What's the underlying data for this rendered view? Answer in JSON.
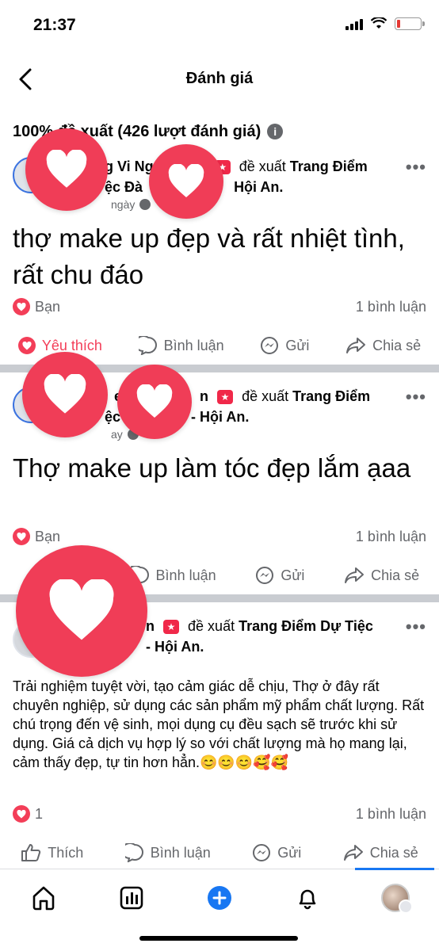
{
  "status_bar": {
    "time": "21:37"
  },
  "header": {
    "title": "Đánh giá"
  },
  "summary": {
    "text": "100% đề xuất (426 lượt đánh giá)",
    "info_icon": "i"
  },
  "posts": [
    {
      "author_partial": "g Vi Ng",
      "recommend_text": "đề xuất",
      "page_name_line1": "Trang Điểm",
      "page_name_line2": "ệc Đà",
      "page_name_line2b": "Hội An.",
      "time": "ngày",
      "body": "thợ make up đẹp và rất nhiệt tình, rất chu đáo",
      "reaction_label": "Bạn",
      "comment_count": "1 bình luận",
      "actions": {
        "like": "Yêu thích",
        "comment": "Bình luận",
        "send": "Gửi",
        "share": "Chia sẻ"
      }
    },
    {
      "author_partial": "en",
      "author_partial2": "n",
      "recommend_text": "đề xuất",
      "page_name_line1": "Trang Điểm",
      "page_name_line2": "ệc",
      "page_name_line2b": "- Hội An.",
      "time": "ay",
      "body": "Thợ make up làm tóc đẹp lắm ạaa",
      "reaction_label": "Bạn",
      "comment_count": "1 bình luận",
      "actions": {
        "comment": "Bình luận",
        "send": "Gửi",
        "share": "Chia sẻ"
      }
    },
    {
      "author_partial": "n",
      "recommend_text": "đề xuất",
      "page_name_line1": "Trang Điểm Dự Tiệc",
      "page_name_line2b": "- Hội An.",
      "body": "Trải nghiệm tuyệt vời, tạo cảm giác dễ chịu, Thợ ở đây rất chuyên nghiệp, sử dụng các sản phẩm mỹ phẩm chất lượng. Rất chú trọng đến vệ sinh, mọi dụng cụ đều sạch sẽ trước khi sử dụng. Giá cả dịch vụ hợp lý so với chất lượng mà họ mang lại, cảm thấy đẹp, tự tin hơn hẳn.😊😊😊🥰🥰",
      "reaction_count": "1",
      "comment_count": "1 bình luận",
      "actions": {
        "like": "Thích",
        "comment": "Bình luận",
        "send": "Gửi",
        "share": "Chia sẻ"
      }
    }
  ],
  "colors": {
    "accent": "#f33e58",
    "link": "#1877f2",
    "muted": "#65676b"
  },
  "bottom_nav": [
    "home-icon",
    "dashboard-icon",
    "create-icon",
    "notifications-icon",
    "profile-avatar"
  ]
}
